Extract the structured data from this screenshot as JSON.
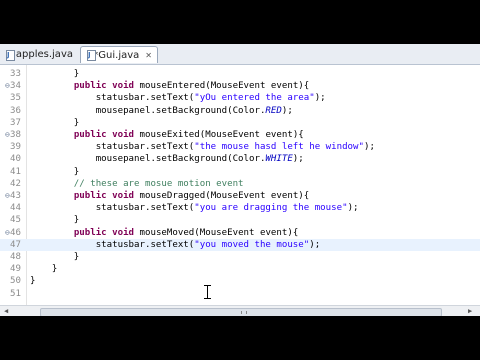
{
  "tabs": [
    {
      "label": "apples.java",
      "active": false
    },
    {
      "label": "*Gui.java",
      "active": true
    }
  ],
  "editor": {
    "lines": [
      {
        "num": "33",
        "fold": "",
        "segments": [
          {
            "t": "        }",
            "c": ""
          }
        ]
      },
      {
        "num": "34",
        "fold": "⊖",
        "segments": [
          {
            "t": "        ",
            "c": ""
          },
          {
            "t": "public void",
            "c": "kw"
          },
          {
            "t": " mouseEntered(MouseEvent event){",
            "c": ""
          }
        ]
      },
      {
        "num": "35",
        "fold": "",
        "segments": [
          {
            "t": "            statusbar.setText(",
            "c": ""
          },
          {
            "t": "\"yOu entered the area\"",
            "c": "str"
          },
          {
            "t": ");",
            "c": ""
          }
        ]
      },
      {
        "num": "36",
        "fold": "",
        "segments": [
          {
            "t": "            mousepanel.setBackground(Color.",
            "c": ""
          },
          {
            "t": "RED",
            "c": "it"
          },
          {
            "t": ");",
            "c": ""
          }
        ]
      },
      {
        "num": "37",
        "fold": "",
        "segments": [
          {
            "t": "        }",
            "c": ""
          }
        ]
      },
      {
        "num": "38",
        "fold": "⊖",
        "segments": [
          {
            "t": "        ",
            "c": ""
          },
          {
            "t": "public void",
            "c": "kw"
          },
          {
            "t": " mouseExited(MouseEvent event){",
            "c": ""
          }
        ]
      },
      {
        "num": "39",
        "fold": "",
        "segments": [
          {
            "t": "            statusbar.setText(",
            "c": ""
          },
          {
            "t": "\"the mouse hasd left he window\"",
            "c": "str"
          },
          {
            "t": ");",
            "c": ""
          }
        ]
      },
      {
        "num": "40",
        "fold": "",
        "segments": [
          {
            "t": "            mousepanel.setBackground(Color.",
            "c": ""
          },
          {
            "t": "WHITE",
            "c": "it"
          },
          {
            "t": ");",
            "c": ""
          }
        ]
      },
      {
        "num": "41",
        "fold": "",
        "segments": [
          {
            "t": "        }",
            "c": ""
          }
        ]
      },
      {
        "num": "42",
        "fold": "",
        "segments": [
          {
            "t": "        // these are mosue motion event",
            "c": "cm"
          }
        ]
      },
      {
        "num": "43",
        "fold": "⊖",
        "segments": [
          {
            "t": "        ",
            "c": ""
          },
          {
            "t": "public void",
            "c": "kw"
          },
          {
            "t": " mouseDragged(MouseEvent event){",
            "c": ""
          }
        ]
      },
      {
        "num": "44",
        "fold": "",
        "segments": [
          {
            "t": "            statusbar.setText(",
            "c": ""
          },
          {
            "t": "\"you are dragging the mouse\"",
            "c": "str"
          },
          {
            "t": ");",
            "c": ""
          }
        ]
      },
      {
        "num": "45",
        "fold": "",
        "segments": [
          {
            "t": "        }",
            "c": ""
          }
        ]
      },
      {
        "num": "46",
        "fold": "⊖",
        "segments": [
          {
            "t": "        ",
            "c": ""
          },
          {
            "t": "public void",
            "c": "kw"
          },
          {
            "t": " mouseMoved(MouseEvent event){",
            "c": ""
          }
        ]
      },
      {
        "num": "47",
        "fold": "",
        "highlight": true,
        "segments": [
          {
            "t": "            statusbar.setText(",
            "c": ""
          },
          {
            "t": "\"you moved the mouse\"",
            "c": "str"
          },
          {
            "t": ");",
            "c": ""
          }
        ]
      },
      {
        "num": "48",
        "fold": "",
        "segments": [
          {
            "t": "        }",
            "c": ""
          }
        ]
      },
      {
        "num": "49",
        "fold": "",
        "segments": [
          {
            "t": "    }",
            "c": ""
          }
        ]
      },
      {
        "num": "50",
        "fold": "",
        "segments": [
          {
            "t": "}",
            "c": ""
          }
        ]
      },
      {
        "num": "51",
        "fold": "",
        "segments": [
          {
            "t": "",
            "c": ""
          }
        ]
      }
    ]
  },
  "colors": {
    "keyword": "#7f0055",
    "string": "#2a00ff",
    "constant": "#0000c0",
    "comment": "#3f7f5f",
    "current_line": "#e8f2fe"
  },
  "icons": {
    "tab_file": "java-file-icon",
    "tab_close": "close-icon",
    "scroll_left": "arrow-left-icon",
    "scroll_right": "arrow-right-icon",
    "pointer": "text-cursor-icon"
  }
}
